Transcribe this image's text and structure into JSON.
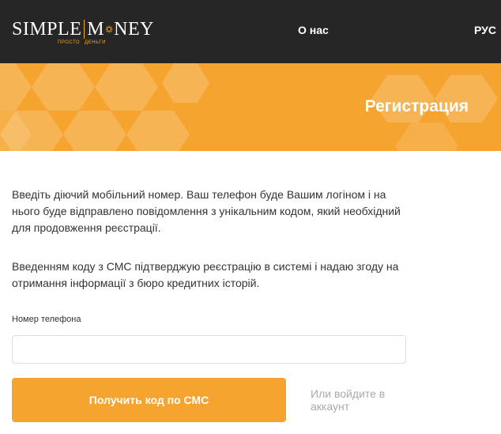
{
  "header": {
    "logo": {
      "word_left": "SIMPLE",
      "word_right_prefix": "M",
      "word_right_suffix": "NEY",
      "tag_left": "ПРОСТО",
      "tag_right": "ДЕНЬГИ",
      "sun_icon": "sun-icon"
    },
    "nav_about": "О нас",
    "nav_lang": "РУС"
  },
  "banner": {
    "title": "Регистрация"
  },
  "main": {
    "intro_text": "Введіть діючий мобільний номер. Ваш телефон буде Вашим логіном і на нього буде відправлено повідомлення з унікальним кодом, який необхідний для продовження реєстрації.",
    "consent_text": "Введенням коду з СМС підтверджую реєстрацію в системі і надаю згоду на отримання інформації з бюро кредитних історій.",
    "phone_label": "Номер телефона",
    "phone_value": "",
    "sms_button_label": "Получить код по СМС",
    "login_link_label": "Или войдите в аккаунт"
  },
  "colors": {
    "header_bg": "#262626",
    "accent": "#f5a430",
    "link_muted": "#aaaaaa"
  }
}
